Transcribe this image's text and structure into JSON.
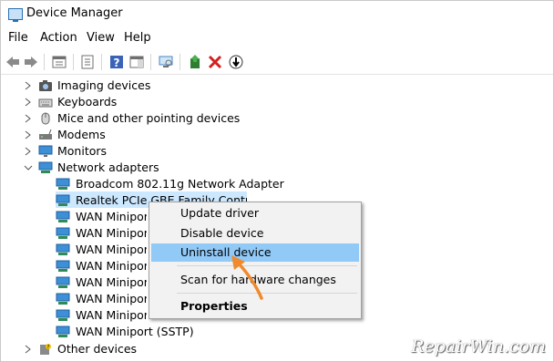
{
  "window": {
    "title": "Device Manager"
  },
  "menubar": {
    "items": [
      "File",
      "Action",
      "View",
      "Help"
    ]
  },
  "toolbar": {
    "icons": [
      "back-icon",
      "forward-icon",
      "properties-icon",
      "show-hide-icon",
      "help-icon",
      "action-pane-icon",
      "scan-hardware-icon",
      "update-driver-icon",
      "uninstall-icon",
      "disable-icon"
    ]
  },
  "tree": {
    "categories": [
      {
        "label": "Imaging devices",
        "icon": "camera-icon"
      },
      {
        "label": "Keyboards",
        "icon": "keyboard-icon"
      },
      {
        "label": "Mice and other pointing devices",
        "icon": "mouse-icon"
      },
      {
        "label": "Modems",
        "icon": "modem-icon"
      },
      {
        "label": "Monitors",
        "icon": "monitor-icon"
      },
      {
        "label": "Network adapters",
        "icon": "network-adapter-icon",
        "expanded": true
      }
    ],
    "network_adapters": [
      "Broadcom 802.11g Network Adapter",
      "Realtek PCIe GBE Family Controller",
      "WAN Miniport",
      "WAN Miniport",
      "WAN Miniport",
      "WAN Miniport",
      "WAN Miniport",
      "WAN Miniport",
      "WAN Miniport",
      "WAN Miniport (SSTP)"
    ],
    "after": {
      "label": "Other devices",
      "icon": "other-devices-icon"
    }
  },
  "context_menu": {
    "update": "Update driver",
    "disable": "Disable device",
    "uninstall": "Uninstall device",
    "scan": "Scan for hardware changes",
    "properties": "Properties"
  },
  "watermark": "RepairWin.com",
  "colors": {
    "selection": "#cce8ff",
    "menu_highlight": "#91c9f7",
    "arrow": "#f08a2c"
  }
}
